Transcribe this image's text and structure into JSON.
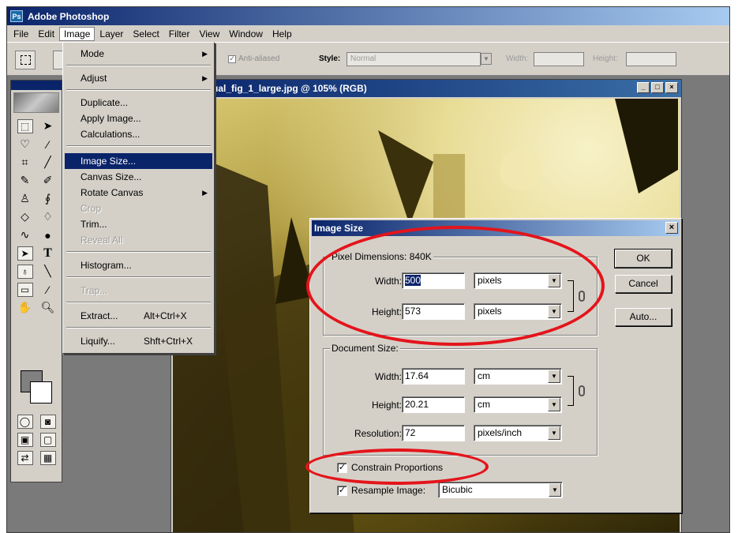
{
  "app": {
    "title": "Adobe Photoshop",
    "menubar": [
      "File",
      "Edit",
      "Image",
      "Layer",
      "Select",
      "Filter",
      "View",
      "Window",
      "Help"
    ],
    "active_menu": "Image"
  },
  "options_bar": {
    "anti_aliased": "Anti-aliased",
    "style_label": "Style:",
    "style_value": "Normal",
    "width_label": "Width:",
    "height_label": "Height:"
  },
  "document": {
    "title": "ual_fig_1_large.jpg @ 105% (RGB)",
    "window_buttons": [
      "_",
      "□",
      "×"
    ]
  },
  "image_menu": {
    "items": [
      {
        "label": "Mode",
        "submenu": true
      },
      {
        "label": "Adjust",
        "submenu": true
      },
      {
        "label": "Duplicate..."
      },
      {
        "label": "Apply Image..."
      },
      {
        "label": "Calculations..."
      },
      {
        "label": "Image Size...",
        "selected": true
      },
      {
        "label": "Canvas Size..."
      },
      {
        "label": "Rotate Canvas",
        "submenu": true
      },
      {
        "label": "Crop",
        "disabled": true
      },
      {
        "label": "Trim..."
      },
      {
        "label": "Reveal All",
        "disabled": true
      },
      {
        "label": "Histogram..."
      },
      {
        "label": "Trap...",
        "disabled": true
      },
      {
        "label": "Extract...",
        "shortcut": "Alt+Ctrl+X"
      },
      {
        "label": "Liquify...",
        "shortcut": "Shft+Ctrl+X"
      }
    ]
  },
  "dialog": {
    "title": "Image Size",
    "pixel_dimensions": {
      "label": "Pixel Dimensions:",
      "size": "840K",
      "width_label": "Width:",
      "width_value": "500",
      "width_unit": "pixels",
      "height_label": "Height:",
      "height_value": "573",
      "height_unit": "pixels"
    },
    "document_size": {
      "label": "Document Size:",
      "width_label": "Width:",
      "width_value": "17.64",
      "width_unit": "cm",
      "height_label": "Height:",
      "height_value": "20.21",
      "height_unit": "cm",
      "resolution_label": "Resolution:",
      "resolution_value": "72",
      "resolution_unit": "pixels/inch"
    },
    "constrain_proportions": {
      "label": "Constrain Proportions",
      "checked": true
    },
    "resample_image": {
      "label": "Resample Image:",
      "checked": true,
      "method": "Bicubic"
    },
    "buttons": {
      "ok": "OK",
      "cancel": "Cancel",
      "auto": "Auto..."
    }
  },
  "colors": {
    "title_blue": "#0a246a",
    "dialog_gray": "#d4d0c8",
    "annotation_red": "#e4141b"
  }
}
